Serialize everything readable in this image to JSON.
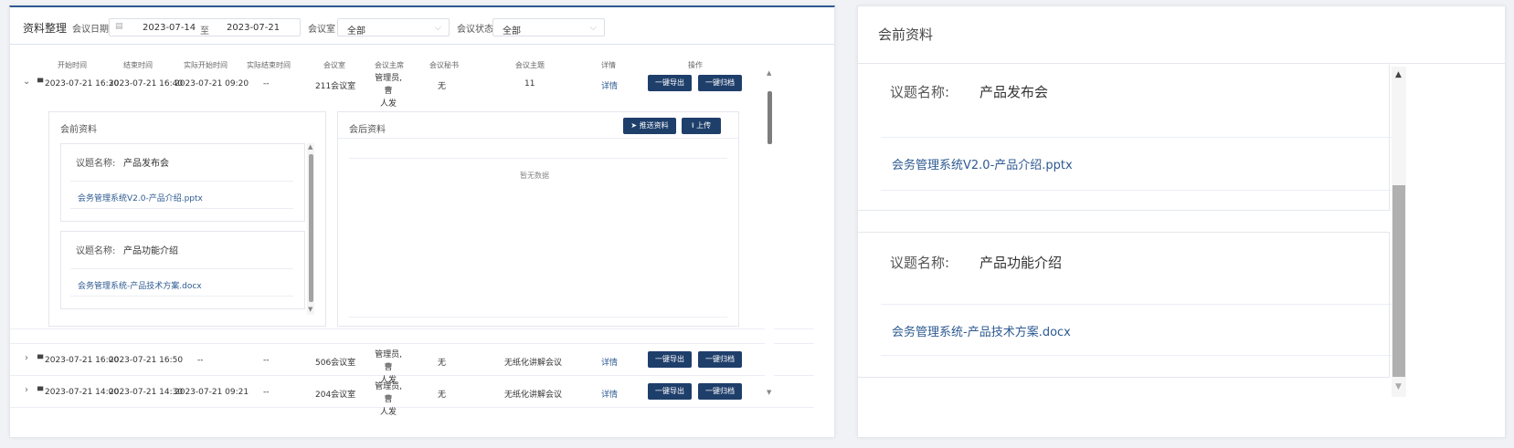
{
  "filter": {
    "title": "资料整理",
    "date_label": "会议日期",
    "calendar_icon": "calendar-icon",
    "date_start": "2023-07-14",
    "date_sep": "至",
    "date_end": "2023-07-21",
    "room_label": "会议室",
    "room_value": "全部",
    "status_label": "会议状态",
    "status_value": "全部"
  },
  "table": {
    "headers": [
      "开始时间",
      "结束时间",
      "实际开始时间",
      "实际结束时间",
      "会议室",
      "会议主席",
      "会议秘书",
      "会议主题",
      "详情",
      "操作"
    ],
    "rows": [
      {
        "start": "2023-07-21 16:30",
        "end": "2023-07-21 16:40",
        "actual_start": "2023-07-21 09:20",
        "actual_end": "--",
        "room": "211会议室",
        "chair_1": "管理员,曹",
        "chair_2": "人发",
        "secretary": "无",
        "topic": "11",
        "detail": "详情",
        "export": "一键导出",
        "archive": "一键归档"
      },
      {
        "start": "2023-07-21 16:00",
        "end": "2023-07-21 16:50",
        "actual_start": "--",
        "actual_end": "--",
        "room": "506会议室",
        "chair_1": "管理员,曹",
        "chair_2": "人发",
        "secretary": "无",
        "topic": "无纸化讲解会议",
        "detail": "详情",
        "export": "一键导出",
        "archive": "一键归档"
      },
      {
        "start": "2023-07-21 14:00",
        "end": "2023-07-21 14:30",
        "actual_start": "2023-07-21 09:21",
        "actual_end": "--",
        "room": "204会议室",
        "chair_1": "管理员,曹",
        "chair_2": "人发",
        "secretary": "无",
        "topic": "无纸化讲解会议",
        "detail": "详情",
        "export": "一键导出",
        "archive": "一键归档"
      }
    ]
  },
  "expanded": {
    "pre_title": "会前资料",
    "post_title": "会后资料",
    "push_btn": "推送资料",
    "upload_btn": "上传",
    "empty": "暂无数据",
    "agendas": [
      {
        "label": "议题名称:",
        "name": "产品发布会",
        "file": "会务管理系统V2.0-产品介绍.pptx"
      },
      {
        "label": "议题名称:",
        "name": "产品功能介绍",
        "file": "会务管理系统-产品技术方案.docx"
      }
    ]
  },
  "zoom": {
    "title": "会前资料",
    "agendas": [
      {
        "label": "议题名称:",
        "name": "产品发布会",
        "file": "会务管理系统V2.0-产品介绍.pptx"
      },
      {
        "label": "议题名称:",
        "name": "产品功能介绍",
        "file": "会务管理系统-产品技术方案.docx"
      }
    ]
  },
  "colors": {
    "primary": "#1f3f6b",
    "link": "#2d5a91",
    "accent_line": "#2f5a8f"
  }
}
